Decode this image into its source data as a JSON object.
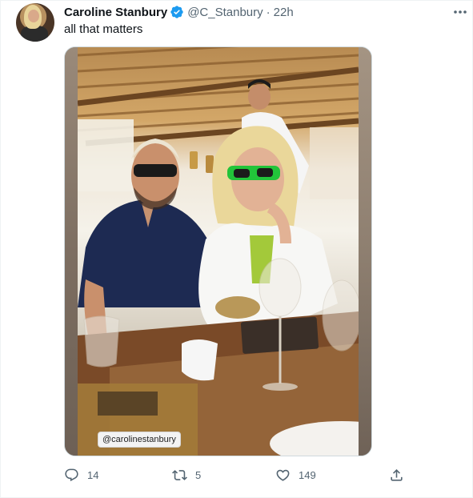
{
  "tweet": {
    "author_name": "Caroline Stanbury",
    "handle": "@C_Stanbury",
    "separator": "·",
    "time": "22h",
    "text": "all that matters",
    "photo_tag": "@carolinestanbury"
  },
  "actions": {
    "reply_count": "14",
    "retweet_count": "5",
    "like_count": "149"
  },
  "icons": {
    "verified": "verified-badge-icon",
    "more": "more-icon",
    "reply": "reply-icon",
    "retweet": "retweet-icon",
    "like": "heart-icon",
    "share": "share-icon"
  },
  "colors": {
    "accent": "#1d9bf0",
    "text_primary": "#0f1419",
    "text_secondary": "#536471"
  }
}
